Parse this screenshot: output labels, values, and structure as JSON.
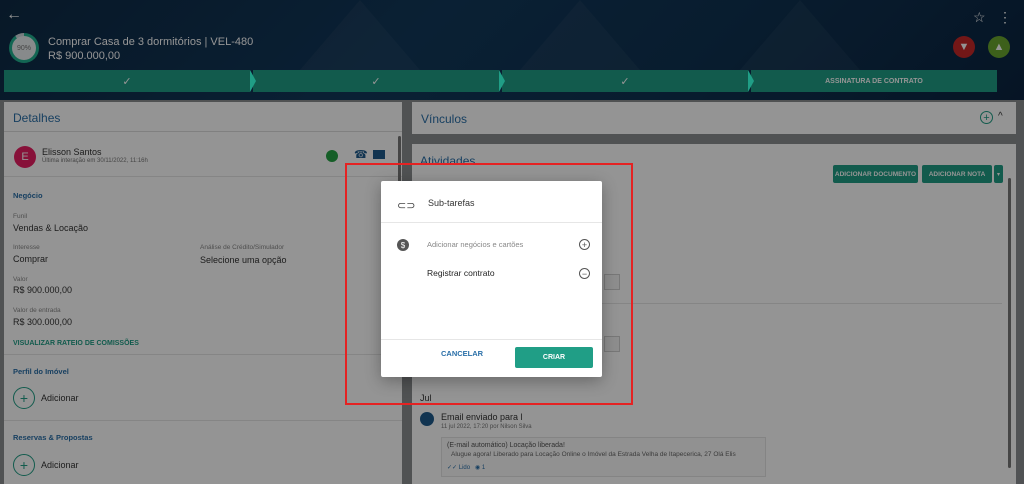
{
  "header": {
    "progress": "90%",
    "progress_fraction": 0.9,
    "title": "Comprar Casa de 3 dormitórios | VEL-480",
    "value": "R$ 900.000,00"
  },
  "stages": [
    {
      "label": "✓",
      "done": true
    },
    {
      "label": "✓",
      "done": true
    },
    {
      "label": "✓",
      "done": true
    },
    {
      "label": "ASSINATURA DE CONTRATO",
      "done": false
    }
  ],
  "details": {
    "title": "Detalhes",
    "contact_initial": "E",
    "contact_name": "Elisson Santos",
    "contact_sub": "Última interação em 30/11/2022, 11:16h",
    "business_section": "Negócio",
    "funnel_label": "Funil",
    "funnel_value": "Vendas & Locação",
    "interest_label": "Interesse",
    "interest_value": "Comprar",
    "credit_label": "Análise de Crédito/Simulador",
    "credit_value": "Selecione uma opção",
    "value_label": "Valor",
    "value_value": "R$ 900.000,00",
    "down_label": "Valor de entrada",
    "down_value": "R$ 300.000,00",
    "commission_link": "VISUALIZAR RATEIO DE COMISSÕES",
    "profile_section": "Perfil do Imóvel",
    "profile_add": "Adicionar",
    "reserves_section": "Reservas & Propostas",
    "reserves_add": "Adicionar"
  },
  "links_panel": {
    "title": "Vínculos"
  },
  "activities": {
    "title": "Atividades",
    "add_document": "ADICIONAR DOCUMENTO",
    "add_note": "ADICIONAR NOTA",
    "month": "Jul",
    "email_title": "Email enviado para l",
    "email_meta": "11 jul 2022, 17:20 por Nilson Silva",
    "email_subject": "(E-mail automático) Locação liberada!",
    "email_body": "Alugue agora! Liberado para Locação Online o Imóvel da Estrada Velha de Itapecerica, 27 Olá Elis",
    "email_read": "Lido",
    "email_views": "1"
  },
  "modal": {
    "title": "Sub-tarefas",
    "add_business": "Adicionar negócios e cartões",
    "task": "Registrar contrato",
    "cancel": "CANCELAR",
    "create": "CRIAR"
  },
  "colors": {
    "accent": "#209e86",
    "header": "#12385a",
    "highlight": "#e52222"
  }
}
